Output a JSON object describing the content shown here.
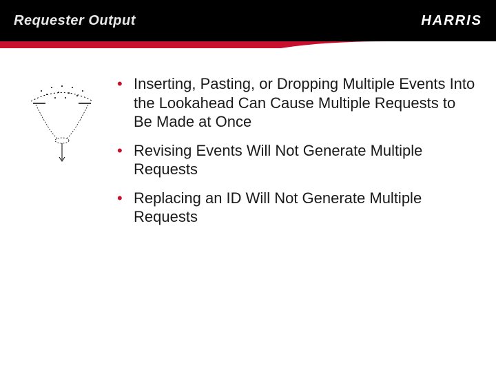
{
  "header": {
    "title": "Requester Output",
    "logo": "HARRIS"
  },
  "accent_color": "#c8102e",
  "bullets": [
    "Inserting, Pasting, or Dropping Multiple Events Into the Lookahead Can Cause Multiple Requests to Be Made at Once",
    "Revising Events Will Not Generate Multiple Requests",
    "Replacing an ID Will Not Generate Multiple Requests"
  ]
}
